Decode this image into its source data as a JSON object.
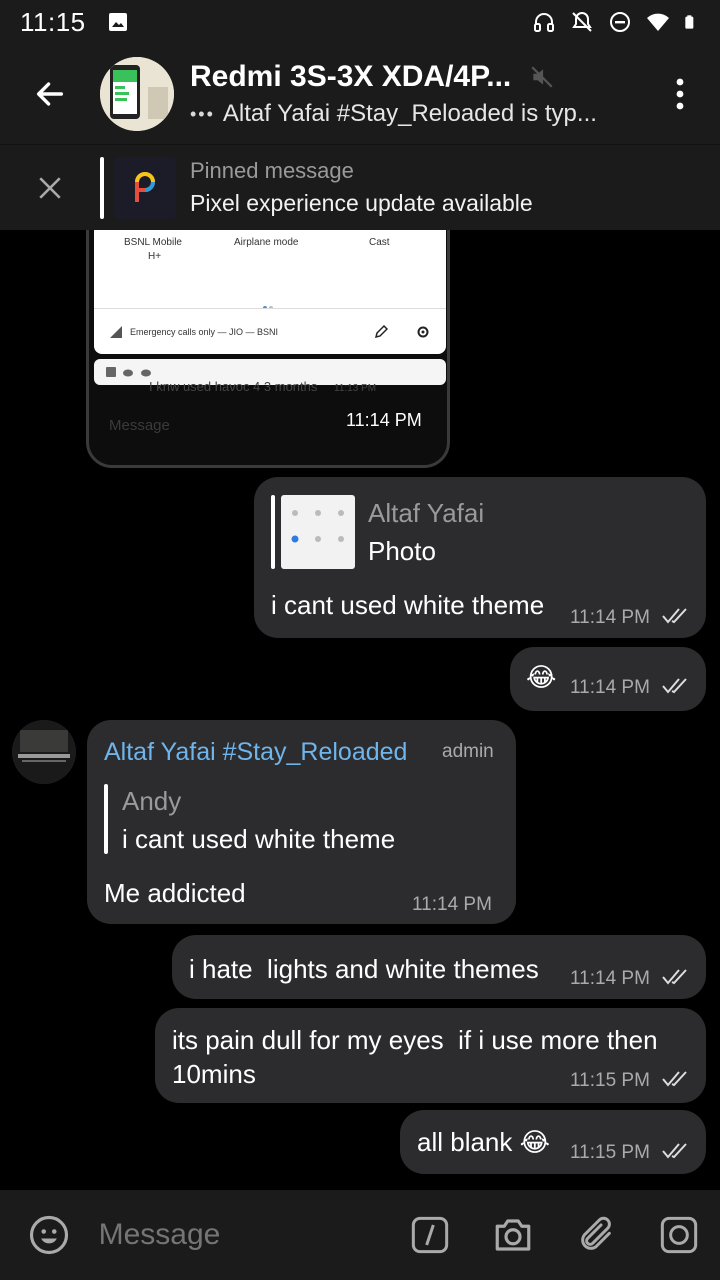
{
  "status_bar": {
    "time": "11:15",
    "icons": [
      "image-icon",
      "headphones-icon",
      "notifications-off-icon",
      "do-not-disturb-icon",
      "wifi-icon",
      "battery-icon"
    ]
  },
  "header": {
    "title": "Redmi 3S-3X XDA/4P...",
    "subtitle": "Altaf Yafai #Stay_Reloaded is typ...",
    "muted": true
  },
  "pinned": {
    "label": "Pinned message",
    "message": "Pixel experience update available"
  },
  "photo_message": {
    "qs_items": [
      "BSNL Mobile",
      "Airplane mode",
      "Cast"
    ],
    "qs_sub": "H+",
    "emergency_text": "Emergency calls only — JIO — BSNI",
    "ghost_text": "I knw used havoc 4 3 months",
    "ghost_time": "11:13 PM",
    "ghost_input": "Message",
    "time": "11:14 PM"
  },
  "messages": [
    {
      "id": "m1",
      "outgoing": true,
      "reply_name": "Altaf Yafai",
      "reply_text": "Photo",
      "text": "i cant used white theme",
      "time": "11:14 PM"
    },
    {
      "id": "m2",
      "outgoing": true,
      "text": "😂",
      "time": "11:14 PM"
    },
    {
      "id": "m3",
      "outgoing": false,
      "sender": "Altaf Yafai #Stay_Reloaded",
      "sender_role": "admin",
      "reply_name": "Andy",
      "reply_text": "i cant used white theme",
      "text": "Me addicted",
      "time": "11:14 PM"
    },
    {
      "id": "m4",
      "outgoing": true,
      "text": "i hate  lights and white themes",
      "time": "11:14 PM"
    },
    {
      "id": "m5",
      "outgoing": true,
      "text": "its pain dull for my eyes  if i use more then 10mins",
      "time": "11:15 PM"
    },
    {
      "id": "m6",
      "outgoing": true,
      "text": "all blank 😂",
      "time": "11:15 PM"
    }
  ],
  "input": {
    "placeholder": "Message"
  },
  "colors": {
    "background": "#000000",
    "bar": "#1b1b1b",
    "bubble": "#2c2c2e",
    "sender_name": "#6fb4ea",
    "meta": "#aaaaaa"
  }
}
